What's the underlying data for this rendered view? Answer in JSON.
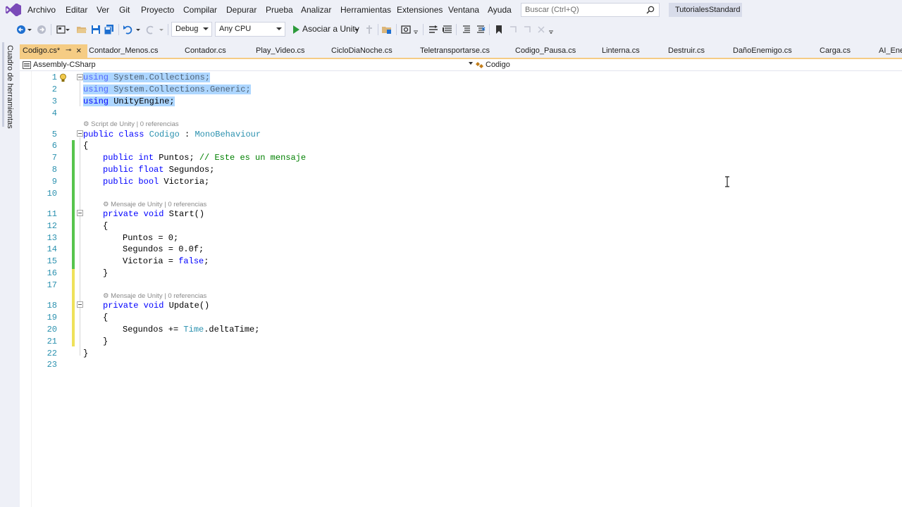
{
  "menu": [
    "Archivo",
    "Editar",
    "Ver",
    "Git",
    "Proyecto",
    "Compilar",
    "Depurar",
    "Prueba",
    "Analizar",
    "Herramientas",
    "Extensiones",
    "Ventana",
    "Ayuda"
  ],
  "search": {
    "placeholder": "Buscar (Ctrl+Q)"
  },
  "solution_name": "TutorialesStandard",
  "toolbar": {
    "config": "Debug",
    "platform": "Any CPU",
    "attach": "Asociar a Unity"
  },
  "sidebar": {
    "toolbox_label": "Cuadro de herramientas"
  },
  "tabs": [
    {
      "label": "Codigo.cs*",
      "active": true
    },
    {
      "label": "Contador_Menos.cs"
    },
    {
      "label": "Contador.cs"
    },
    {
      "label": "Play_Video.cs"
    },
    {
      "label": "CicloDiaNoche.cs"
    },
    {
      "label": "Teletransportarse.cs"
    },
    {
      "label": "Codigo_Pausa.cs"
    },
    {
      "label": "Linterna.cs"
    },
    {
      "label": "Destruir.cs"
    },
    {
      "label": "DañoEnemigo.cs"
    },
    {
      "label": "Carga.cs"
    },
    {
      "label": "AI_Ener"
    }
  ],
  "navbar": {
    "project": "Assembly-CSharp",
    "class": "Codigo"
  },
  "lens": {
    "class": "Script de Unity | 0 referencias",
    "start": "Mensaje de Unity | 0 referencias",
    "update": "Mensaje de Unity | 0 referencias"
  },
  "line_numbers": [
    "1",
    "2",
    "3",
    "4",
    "5",
    "6",
    "7",
    "8",
    "9",
    "10",
    "11",
    "12",
    "13",
    "14",
    "15",
    "16",
    "17",
    "18",
    "19",
    "20",
    "21",
    "22",
    "23"
  ],
  "code": {
    "l1_kw": "using",
    "l1_rest": " System.Collections;",
    "l2_kw": "using",
    "l2_rest": " System.Collections.Generic;",
    "l3_kw": "using",
    "l3_rest": " UnityEngine;",
    "l5_kw1": "public",
    "l5_kw2": "class",
    "l5_name": "Codigo",
    "l5_colon": " : ",
    "l5_base": "MonoBehaviour",
    "l6": "{",
    "l7_kw1": "public",
    "l7_kw2": "int",
    "l7_rest": " Puntos; ",
    "l7_comment": "// Este es un mensaje",
    "l8_kw1": "public",
    "l8_kw2": "float",
    "l8_rest": " Segundos;",
    "l9_kw1": "public",
    "l9_kw2": "bool",
    "l9_rest": " Victoria;",
    "l11_kw1": "private",
    "l11_kw2": "void",
    "l11_rest": " Start()",
    "l12": "{",
    "l13": "Puntos = 0;",
    "l14": "Segundos = 0.0f;",
    "l15_a": "Victoria = ",
    "l15_kw": "false",
    "l15_b": ";",
    "l16": "}",
    "l18_kw1": "private",
    "l18_kw2": "void",
    "l18_rest": " Update()",
    "l19": "{",
    "l20_a": "Segundos += ",
    "l20_type": "Time",
    "l20_b": ".deltaTime;",
    "l21": "}",
    "l22": "}"
  },
  "colors": {
    "accent": "#68217a",
    "active_tab": "#f5cc84",
    "keyword": "#0000ff",
    "type": "#2b91af",
    "comment": "#008000",
    "selection": "#add6ff",
    "changed_saved": "#57c44d",
    "changed_unsaved": "#efe15a"
  }
}
